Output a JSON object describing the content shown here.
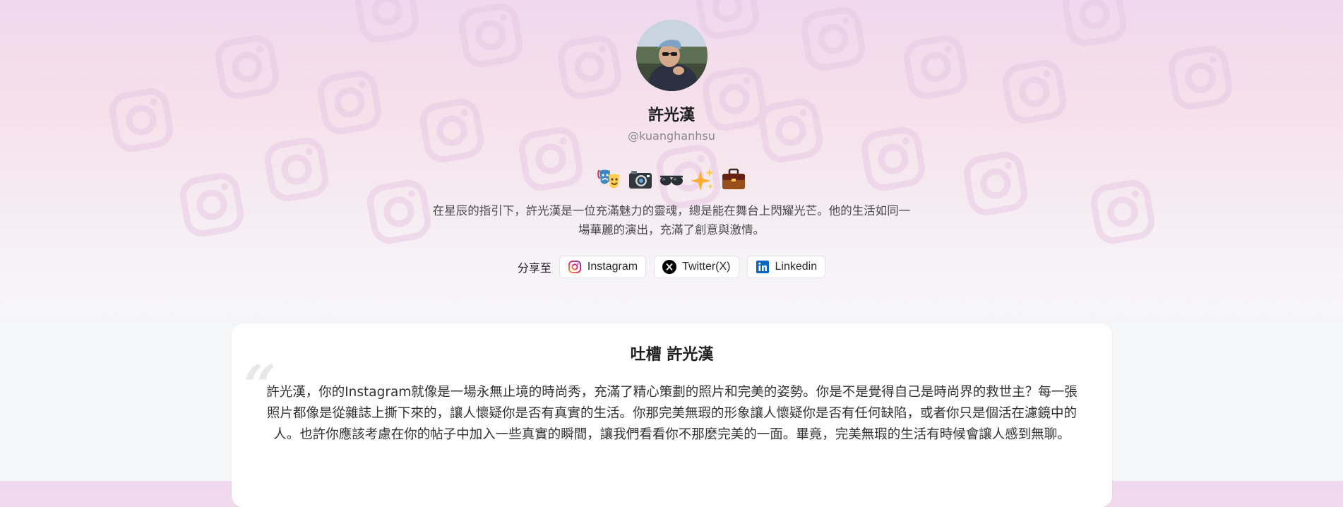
{
  "profile": {
    "name": "許光漢",
    "handle": "@kuanghanhsu",
    "emojis": [
      "theater-masks-icon",
      "camera-icon",
      "sunglasses-icon",
      "sparkles-icon",
      "briefcase-icon"
    ],
    "bio": "在星辰的指引下，許光漢是一位充滿魅力的靈魂，總是能在舞台上閃耀光芒。他的生活如同一場華麗的演出，充滿了創意與激情。"
  },
  "share": {
    "label": "分享至",
    "buttons": [
      {
        "label": "Instagram",
        "icon": "instagram-icon"
      },
      {
        "label": "Twitter(X)",
        "icon": "x-icon"
      },
      {
        "label": "Linkedin",
        "icon": "linkedin-icon"
      }
    ]
  },
  "roast": {
    "title": "吐槽 許光漢",
    "text": "許光漢，你的Instagram就像是一場永無止境的時尚秀，充滿了精心策劃的照片和完美的姿勢。你是不是覺得自己是時尚界的救世主？每一張照片都像是從雜誌上撕下來的，讓人懷疑你是否有真實的生活。你那完美無瑕的形象讓人懷疑你是否有任何缺陷，或者你只是個活在濾鏡中的人。也許你應該考慮在你的帖子中加入一些真實的瞬間，讓我們看看你不那麼完美的一面。畢竟，完美無瑕的生活有時候會讓人感到無聊。"
  },
  "colors": {
    "background_top": "#f0d8ee",
    "background_bottom": "#f5f6f8",
    "card": "#ffffff",
    "muted_text": "#8a8a8a",
    "linkedin_blue": "#0a66c2"
  }
}
